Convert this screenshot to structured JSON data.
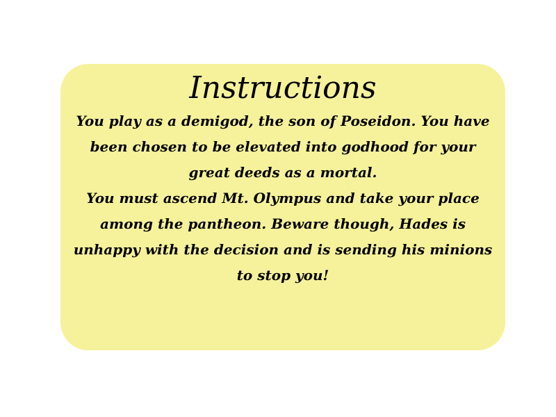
{
  "colors": {
    "page_background": "#ffffff",
    "panel_background": "#f5f29b",
    "text": "#000000"
  },
  "instructions": {
    "title": "Instructions",
    "paragraph_1": "You play as a demigod, the son of Poseidon. You have been chosen to be elevated into godhood for your great deeds as a mortal.",
    "paragraph_2": "You must ascend Mt. Olympus and take your place among the pantheon. Beware though, Hades is unhappy with the decision and is sending his minions to stop you!"
  }
}
